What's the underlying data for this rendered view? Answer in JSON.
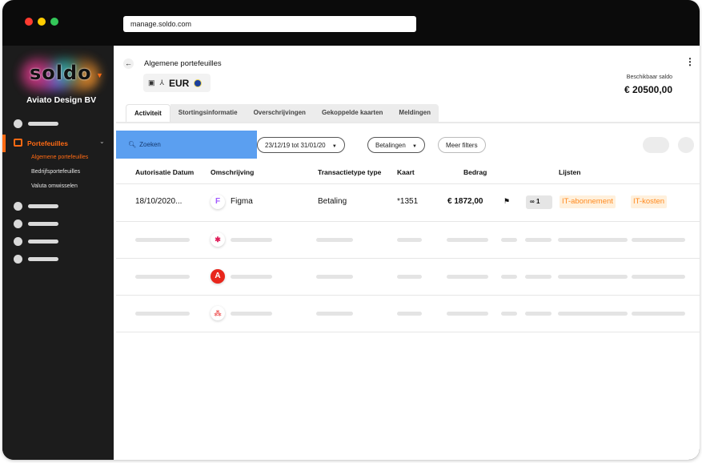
{
  "browser": {
    "url": "manage.soldo.com",
    "dot_colors": [
      "#ff3b30",
      "#ffcc00",
      "#34c759"
    ]
  },
  "sidebar": {
    "logo_text": "soldo",
    "company": "Aviato Design BV",
    "section_label": "Portefeuilles",
    "sub_items": [
      {
        "label": "Algemene portefeuilles",
        "active": true
      },
      {
        "label": "Bedrijfsportefeuilles",
        "active": false
      },
      {
        "label": "Valuta omwisselen",
        "active": false
      }
    ]
  },
  "wallet": {
    "title": "Algemene portefeuilles",
    "currency": "EUR",
    "balance_label": "Beschikbaar saldo",
    "balance_value": "€ 20500,00"
  },
  "tabs": [
    "Activiteit",
    "Stortingsinformatie",
    "Overschrijvingen",
    "Gekoppelde kaarten",
    "Meldingen"
  ],
  "filters": {
    "search_placeholder": "Zoeken",
    "date_range": "23/12/19 tot 31/01/20",
    "type": "Betalingen",
    "more": "Meer filters"
  },
  "table": {
    "headers": [
      "Autorisatie Datum",
      "Omschrijving",
      "Transactietype type",
      "Kaart",
      "Bedrag",
      "Lijsten"
    ],
    "row": {
      "date": "18/10/2020...",
      "description": "Figma",
      "type": "Betaling",
      "card": "*1351",
      "amount": "€ 1872,00",
      "attachments": "1",
      "tags": [
        "IT-abonnement",
        "IT-kosten"
      ]
    },
    "placeholder_icons": [
      "slack-icon",
      "adobe-icon",
      "asana-icon"
    ]
  },
  "colors": {
    "accent": "#ff6a13",
    "search_bg": "#5b9ff0",
    "tag_bg": "#fff0dc",
    "tag_text": "#ff8a1f"
  }
}
